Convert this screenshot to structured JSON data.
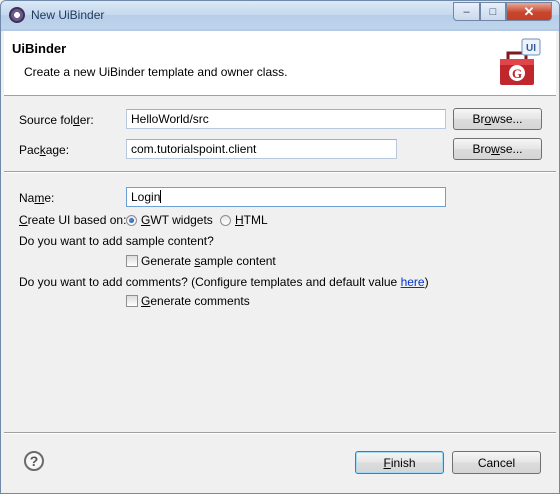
{
  "window": {
    "title": "New UiBinder",
    "minimize_glyph": "–",
    "maximize_glyph": "□",
    "close_glyph": "✕"
  },
  "banner": {
    "title": "UiBinder",
    "description": "Create a new UiBinder template and owner class.",
    "icon_letters": "G",
    "icon_badge": "UI"
  },
  "form": {
    "source_folder": {
      "label_pre": "Source fol",
      "label_ul": "d",
      "label_post": "er:",
      "value": "HelloWorld/src",
      "browse_pre": "Br",
      "browse_ul": "o",
      "browse_post": "wse..."
    },
    "package": {
      "label_pre": "Pac",
      "label_ul": "k",
      "label_post": "age:",
      "value": "com.tutorialspoint.client",
      "browse_pre": "Bro",
      "browse_ul": "w",
      "browse_post": "se..."
    },
    "name": {
      "label_pre": "Na",
      "label_ul": "m",
      "label_post": "e:",
      "value": "Login"
    },
    "create_ui": {
      "label_pre": "",
      "label_ul": "C",
      "label_post": "reate UI based on:",
      "options": [
        {
          "pre": "",
          "ul": "G",
          "post": "WT widgets",
          "checked": true
        },
        {
          "pre": "",
          "ul": "H",
          "post": "TML",
          "checked": false
        }
      ]
    },
    "sample_content": {
      "question": "Do you want to add sample content?",
      "pre": "Generate ",
      "ul": "s",
      "post": "ample content",
      "checked": false
    },
    "comments": {
      "question_pre": "Do you want to add comments? (Configure templates and default value ",
      "link": "here",
      "question_post": ")",
      "pre": "",
      "ul": "G",
      "post": "enerate comments",
      "checked": false
    }
  },
  "footer": {
    "help_glyph": "?",
    "finish_pre": "",
    "finish_ul": "F",
    "finish_post": "inish",
    "cancel": "Cancel"
  },
  "colors": {
    "link": "#0033cc",
    "title_text": "#1e395b",
    "close_red": "#c7462c"
  }
}
